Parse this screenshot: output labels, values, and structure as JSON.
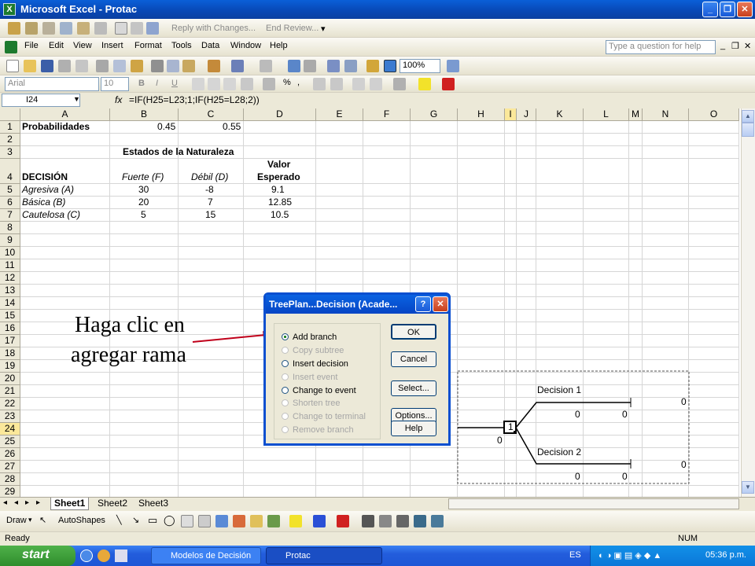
{
  "window": {
    "title": "Microsoft Excel - Protac"
  },
  "reviewbar": {
    "reply": "Reply with Changes...",
    "end_review": "End Review..."
  },
  "menu": {
    "items": [
      "File",
      "Edit",
      "View",
      "Insert",
      "Format",
      "Tools",
      "Data",
      "Window",
      "Help"
    ],
    "help_placeholder": "Type a question for help"
  },
  "standard": {
    "zoom": "100%"
  },
  "formatting": {
    "font": "Arial",
    "size": "10"
  },
  "formula_bar": {
    "name_box": "I24",
    "fx": "fx",
    "formula": "=IF(H25=L23;1;IF(H25=L28;2))"
  },
  "grid": {
    "columns": [
      "A",
      "B",
      "C",
      "D",
      "E",
      "F",
      "G",
      "H",
      "I",
      "J",
      "K",
      "L",
      "M",
      "N",
      "O"
    ],
    "rows": [
      "1",
      "2",
      "3",
      "4",
      "5",
      "6",
      "7",
      "8",
      "9",
      "10",
      "11",
      "12",
      "13",
      "14",
      "15",
      "16",
      "17",
      "18",
      "19",
      "20",
      "21",
      "22",
      "23",
      "24",
      "25",
      "26",
      "27",
      "28",
      "29"
    ],
    "cells": {
      "A1": "Probabilidades",
      "B1": "0.45",
      "C1": "0.55",
      "B3": "Estados de la Naturaleza",
      "A4": "DECISIÓN",
      "B4": "Fuerte (F)",
      "C4": "Débil (D)",
      "D4a": "Valor",
      "D4b": "Esperado",
      "A5": "Agresiva (A)",
      "B5": "30",
      "C5": "-8",
      "D5": "9.1",
      "A6": "Básica (B)",
      "B6": "20",
      "C6": "7",
      "D6": "12.85",
      "A7": "Cautelosa (C)",
      "B7": "5",
      "C7": "15",
      "D7": "10.5"
    },
    "tree": {
      "decision1": "Decision 1",
      "decision2": "Decision 2",
      "node": "1",
      "zero": "0"
    }
  },
  "annotation": {
    "line1": "Haga clic en",
    "line2": "agregar rama"
  },
  "dialog": {
    "title": "TreePlan...Decision  (Acade...",
    "options": [
      {
        "label": "Add branch",
        "enabled": true,
        "selected": true
      },
      {
        "label": "Copy subtree",
        "enabled": false
      },
      {
        "label": "Insert decision",
        "enabled": true
      },
      {
        "label": "Insert event",
        "enabled": false
      },
      {
        "label": "Change to event",
        "enabled": true
      },
      {
        "label": "Shorten tree",
        "enabled": false
      },
      {
        "label": "Change to terminal",
        "enabled": false
      },
      {
        "label": "Remove branch",
        "enabled": false
      }
    ],
    "buttons": {
      "ok": "OK",
      "cancel": "Cancel",
      "select": "Select...",
      "options": "Options...",
      "help": "Help"
    }
  },
  "sheets": {
    "tabs": [
      "Sheet1",
      "Sheet2",
      "Sheet3"
    ]
  },
  "drawbar": {
    "draw": "Draw",
    "autoshapes": "AutoShapes"
  },
  "status": {
    "left": "Ready",
    "num": "NUM"
  },
  "taskbar": {
    "start": "start",
    "items": [
      "Modelos de Decisión",
      "Protac"
    ],
    "lang": "ES",
    "clock": "05:36 p.m."
  }
}
